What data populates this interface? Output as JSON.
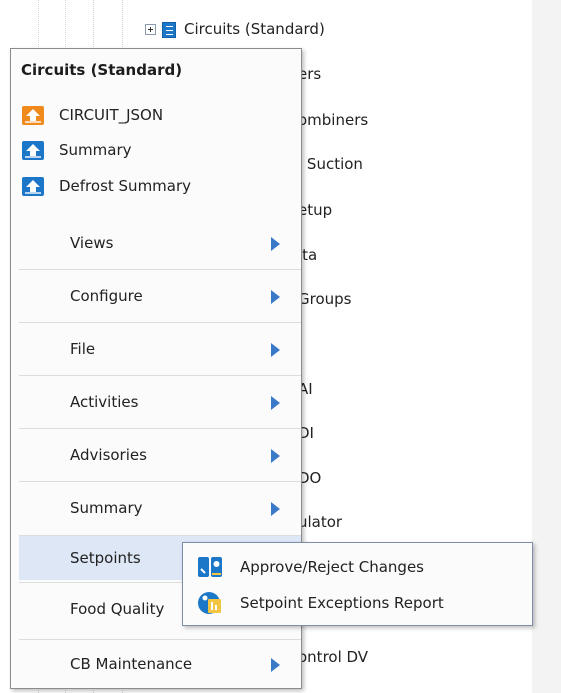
{
  "tree": {
    "header_row": {
      "label": "Circuits (Standard)"
    },
    "partial_rows": [
      "ers",
      "ombiners",
      "l Suction",
      "etup",
      "ita",
      "Groups",
      "AI",
      "DI",
      "DO",
      "ulator",
      "ontrol DV"
    ]
  },
  "menu": {
    "title": "Circuits (Standard)",
    "actions": [
      {
        "label": "CIRCUIT_JSON",
        "icon": "orange-network-icon",
        "color": "#f08a1c"
      },
      {
        "label": "Summary",
        "icon": "blue-network-icon",
        "color": "#1d77c9"
      },
      {
        "label": "Defrost Summary",
        "icon": "blue-network-icon",
        "color": "#1d77c9"
      }
    ],
    "submenus": [
      {
        "label": "Views",
        "has_arrow": true
      },
      {
        "label": "Configure",
        "has_arrow": true
      },
      {
        "label": "File",
        "has_arrow": true
      },
      {
        "label": "Activities",
        "has_arrow": true
      },
      {
        "label": "Advisories",
        "has_arrow": true
      },
      {
        "label": "Summary",
        "has_arrow": true
      },
      {
        "label": "Setpoints",
        "has_arrow": false,
        "active": true
      },
      {
        "label": "Food Quality",
        "has_arrow": false
      },
      {
        "label": "CB Maintenance",
        "has_arrow": true
      }
    ]
  },
  "setpoints_submenu": {
    "items": [
      {
        "label": "Approve/Reject Changes",
        "icon": "approve-reject-icon"
      },
      {
        "label": "Setpoint Exceptions Report",
        "icon": "exceptions-report-icon"
      }
    ]
  },
  "colors": {
    "accent_blue": "#1d77c9",
    "accent_orange": "#f08a1c",
    "highlight": "#dde7f5",
    "arrow": "#3a78c8"
  }
}
